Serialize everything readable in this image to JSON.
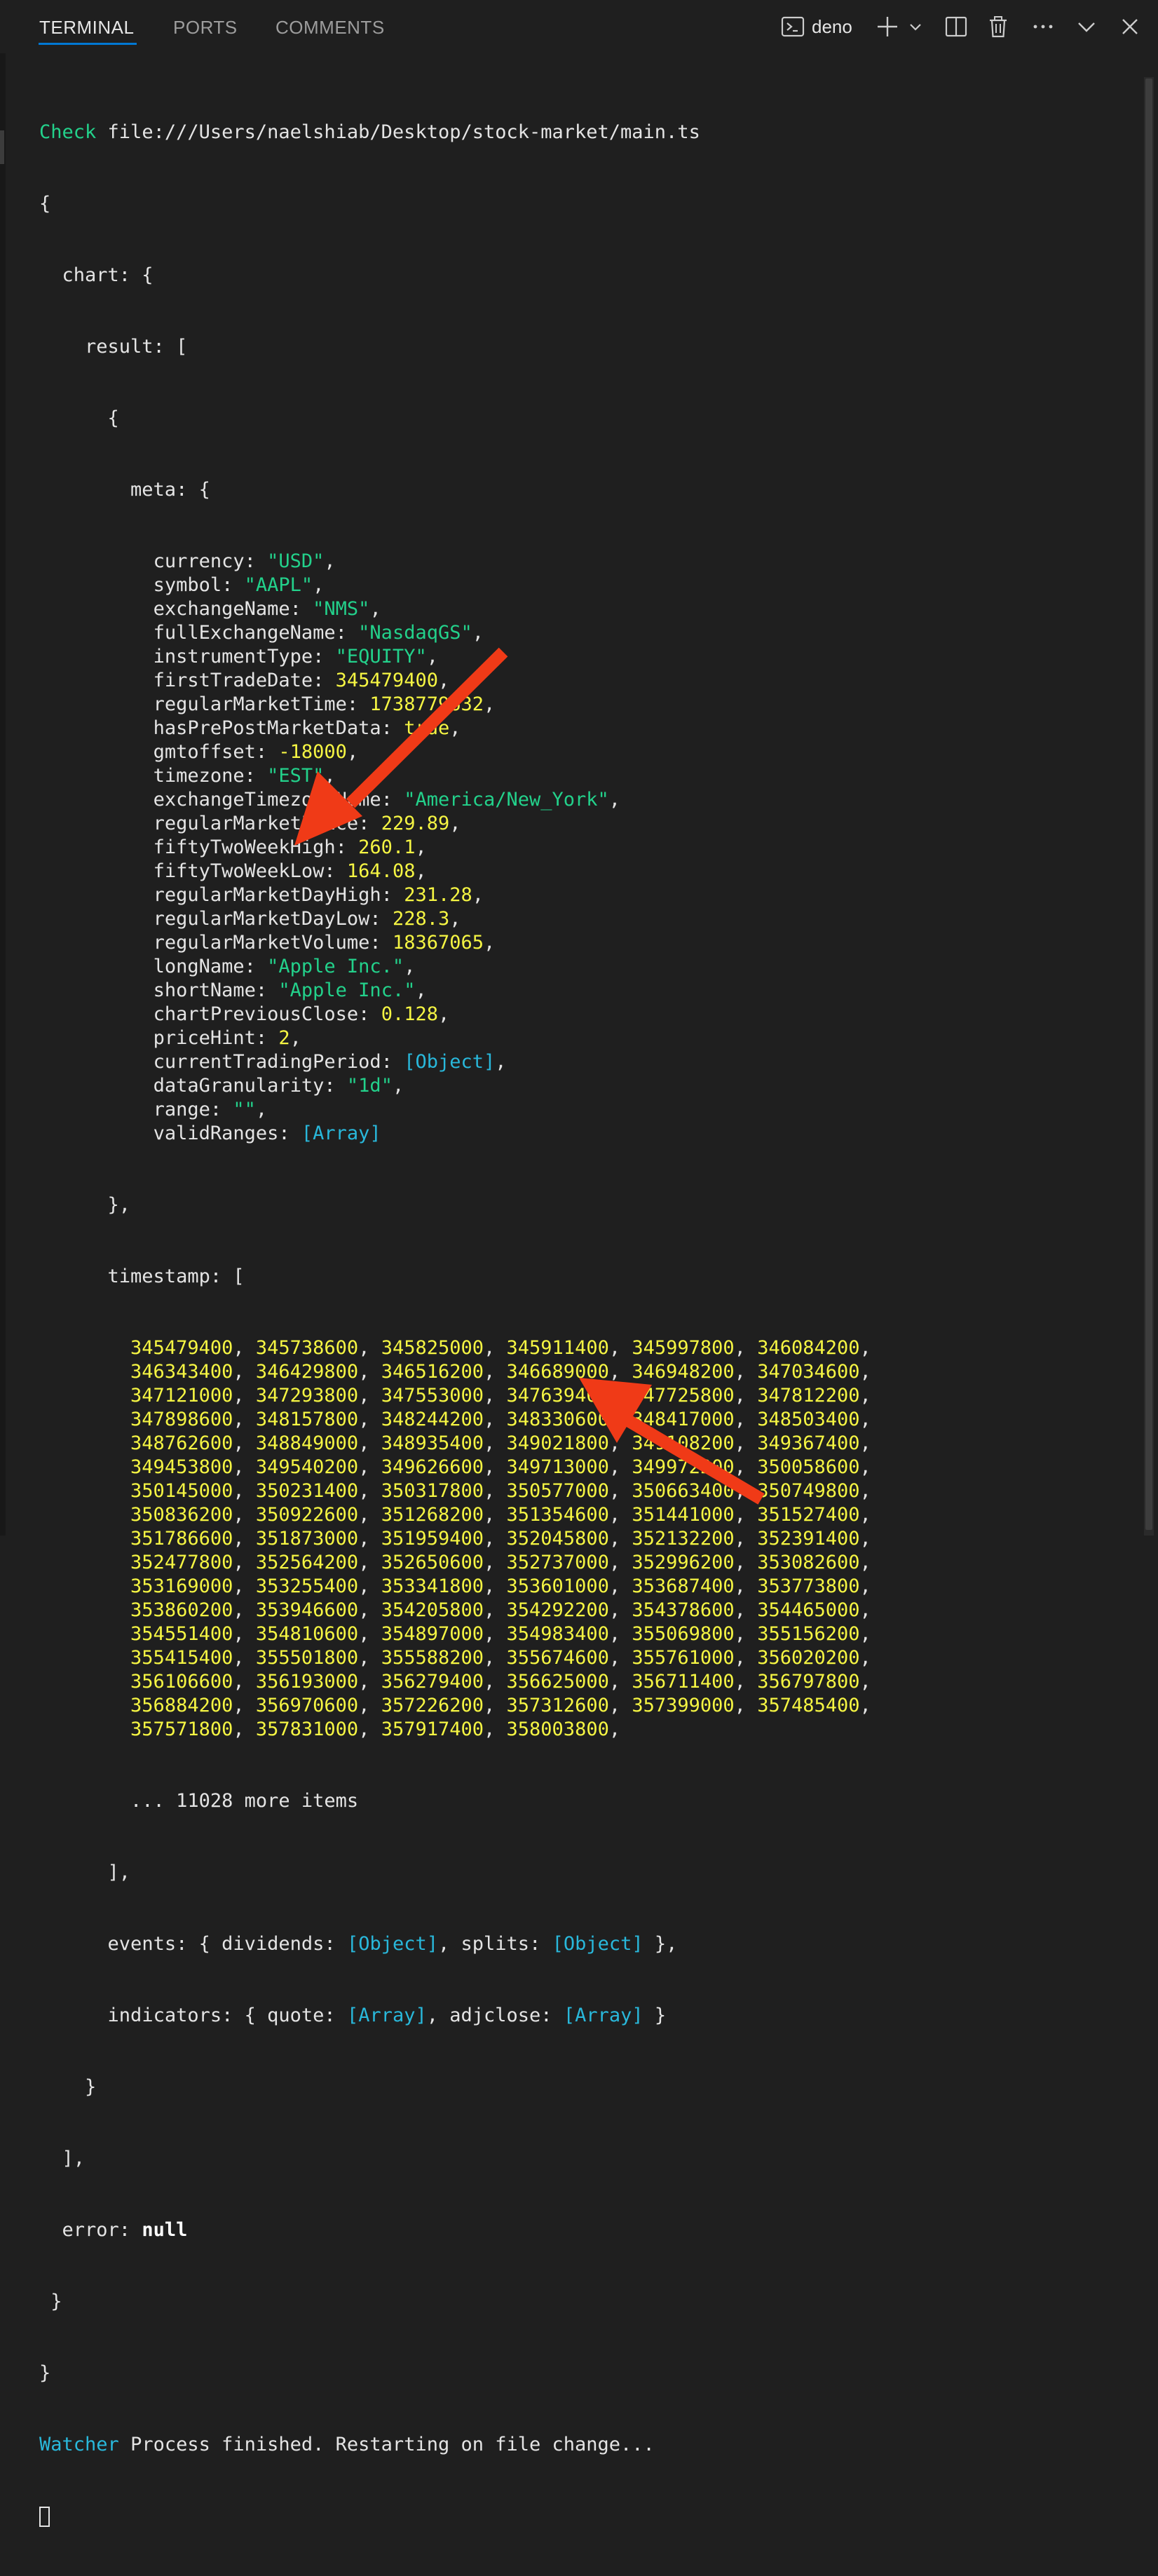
{
  "tabs": [
    "TERMINAL",
    "PORTS",
    "COMMENTS"
  ],
  "toolbar": {
    "shell_name": "deno",
    "icons": [
      "terminal-icon",
      "plus-icon",
      "chevron-down-icon",
      "split-icon",
      "trash-icon",
      "more-icon",
      "chevron-down-icon",
      "close-icon"
    ]
  },
  "colors": {
    "background": "#1f1f1f",
    "accent": "#0078d4",
    "string": "#23d18b",
    "number": "#f5f543",
    "special": "#29b8db",
    "arrow": "#f03a17"
  },
  "terminal": {
    "check_label": "Check",
    "check_path": "file:///Users/naelshiab/Desktop/stock-market/main.ts",
    "meta": [
      [
        "currency",
        "\"USD\"",
        "s"
      ],
      [
        "symbol",
        "\"AAPL\"",
        "s"
      ],
      [
        "exchangeName",
        "\"NMS\"",
        "s"
      ],
      [
        "fullExchangeName",
        "\"NasdaqGS\"",
        "s"
      ],
      [
        "instrumentType",
        "\"EQUITY\"",
        "s"
      ],
      [
        "firstTradeDate",
        "345479400",
        "n"
      ],
      [
        "regularMarketTime",
        "1738779632",
        "n"
      ],
      [
        "hasPrePostMarketData",
        "true",
        "b"
      ],
      [
        "gmtoffset",
        "-18000",
        "n"
      ],
      [
        "timezone",
        "\"EST\"",
        "s"
      ],
      [
        "exchangeTimezoneName",
        "\"America/New_York\"",
        "s"
      ],
      [
        "regularMarketPrice",
        "229.89",
        "n"
      ],
      [
        "fiftyTwoWeekHigh",
        "260.1",
        "n"
      ],
      [
        "fiftyTwoWeekLow",
        "164.08",
        "n"
      ],
      [
        "regularMarketDayHigh",
        "231.28",
        "n"
      ],
      [
        "regularMarketDayLow",
        "228.3",
        "n"
      ],
      [
        "regularMarketVolume",
        "18367065",
        "n"
      ],
      [
        "longName",
        "\"Apple Inc.\"",
        "s"
      ],
      [
        "shortName",
        "\"Apple Inc.\"",
        "s"
      ],
      [
        "chartPreviousClose",
        "0.128",
        "n"
      ],
      [
        "priceHint",
        "2",
        "n"
      ],
      [
        "currentTradingPeriod",
        "[Object]",
        "r"
      ],
      [
        "dataGranularity",
        "\"1d\"",
        "s"
      ],
      [
        "range",
        "\"\"",
        "s"
      ],
      [
        "validRanges",
        "[Array]",
        "r"
      ]
    ],
    "timestamp_rows": [
      [
        "345479400",
        "345738600",
        "345825000",
        "345911400",
        "345997800",
        "346084200"
      ],
      [
        "346343400",
        "346429800",
        "346516200",
        "346689000",
        "346948200",
        "347034600"
      ],
      [
        "347121000",
        "347293800",
        "347553000",
        "347639400",
        "347725800",
        "347812200"
      ],
      [
        "347898600",
        "348157800",
        "348244200",
        "348330600",
        "348417000",
        "348503400"
      ],
      [
        "348762600",
        "348849000",
        "348935400",
        "349021800",
        "349108200",
        "349367400"
      ],
      [
        "349453800",
        "349540200",
        "349626600",
        "349713000",
        "349972200",
        "350058600"
      ],
      [
        "350145000",
        "350231400",
        "350317800",
        "350577000",
        "350663400",
        "350749800"
      ],
      [
        "350836200",
        "350922600",
        "351268200",
        "351354600",
        "351441000",
        "351527400"
      ],
      [
        "351786600",
        "351873000",
        "351959400",
        "352045800",
        "352132200",
        "352391400"
      ],
      [
        "352477800",
        "352564200",
        "352650600",
        "352737000",
        "352996200",
        "353082600"
      ],
      [
        "353169000",
        "353255400",
        "353341800",
        "353601000",
        "353687400",
        "353773800"
      ],
      [
        "353860200",
        "353946600",
        "354205800",
        "354292200",
        "354378600",
        "354465000"
      ],
      [
        "354551400",
        "354810600",
        "354897000",
        "354983400",
        "355069800",
        "355156200"
      ],
      [
        "355415400",
        "355501800",
        "355588200",
        "355674600",
        "355761000",
        "356020200"
      ],
      [
        "356106600",
        "356193000",
        "356279400",
        "356625000",
        "356711400",
        "356797800"
      ],
      [
        "356884200",
        "356970600",
        "357226200",
        "357312600",
        "357399000",
        "357485400"
      ],
      [
        "357571800",
        "357831000",
        "357917400",
        "358003800"
      ]
    ],
    "more_items": "... 11028 more items",
    "events_line": {
      "key": "events",
      "dividends": "dividends",
      "dividends_value": "[Object]",
      "splits": "splits",
      "splits_value": "[Object]"
    },
    "indicators_line": {
      "key": "indicators",
      "quote": "quote",
      "quote_value": "[Array]",
      "adjclose": "adjclose",
      "adjclose_value": "[Array]"
    },
    "error_key": "error",
    "error_value": "null",
    "watcher_label": "Watcher",
    "watcher_message": "Process finished. Restarting on file change..."
  }
}
